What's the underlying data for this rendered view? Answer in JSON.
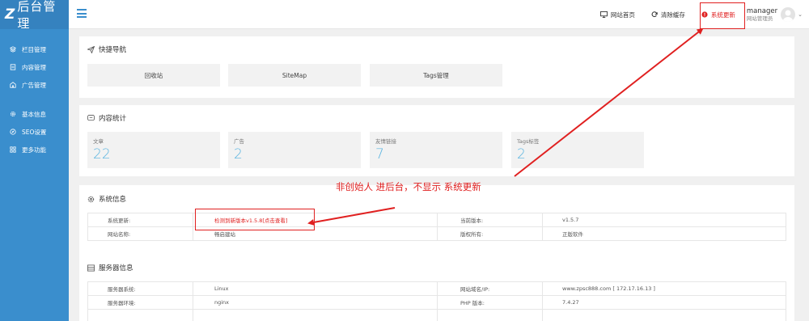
{
  "app": {
    "logo_mark": "Z",
    "logo_text": "后台管理"
  },
  "sidebar": {
    "items": [
      {
        "label": "栏目管理",
        "icon": "layers-icon"
      },
      {
        "label": "内容管理",
        "icon": "document-icon"
      },
      {
        "label": "广告管理",
        "icon": "ad-icon"
      },
      {
        "label": "基本信息",
        "icon": "gear-icon"
      },
      {
        "label": "SEO设置",
        "icon": "compass-icon"
      },
      {
        "label": "更多功能",
        "icon": "grid-icon"
      }
    ]
  },
  "topbar": {
    "home_label": "网站首页",
    "clear_cache_label": "清除缓存",
    "update_label": "系统更新",
    "user_name": "manager",
    "user_role": "网站管理员"
  },
  "quick_nav": {
    "title": "快捷导航",
    "buttons": [
      "回收站",
      "SiteMap",
      "Tags管理"
    ]
  },
  "stats": {
    "title": "内容统计",
    "items": [
      {
        "label": "文章",
        "value": "22"
      },
      {
        "label": "广告",
        "value": "2"
      },
      {
        "label": "友情链接",
        "value": "7"
      },
      {
        "label": "Tags标签",
        "value": "2"
      }
    ]
  },
  "system_info": {
    "title": "系统信息",
    "rows": [
      {
        "k1": "系统更新:",
        "v1": "检测到新版本v1.5.8[点击查看]",
        "k2": "当前版本:",
        "v2": "v1.5.7"
      },
      {
        "k1": "网站名称:",
        "v1": "畅启建站",
        "k2": "版权所有:",
        "v2": "正版软件"
      }
    ]
  },
  "server_info": {
    "title": "服务器信息",
    "rows": [
      {
        "k1": "服务器系统:",
        "v1": "Linux",
        "k2": "网站域名/IP:",
        "v2": "www.zpsc888.com [ 172.17.16.13 ]"
      },
      {
        "k1": "服务器环境:",
        "v1": "nginx",
        "k2": "PHP 版本:",
        "v2": "7.4.27"
      },
      {
        "k1": "",
        "v1": "",
        "k2": "",
        "v2": ""
      }
    ]
  },
  "annotation": {
    "text": "非创始人 进后台，不显示 系统更新"
  },
  "colors": {
    "sidebar": "#3a8ecd",
    "accent": "#57b3e0",
    "alert": "#e02020"
  }
}
